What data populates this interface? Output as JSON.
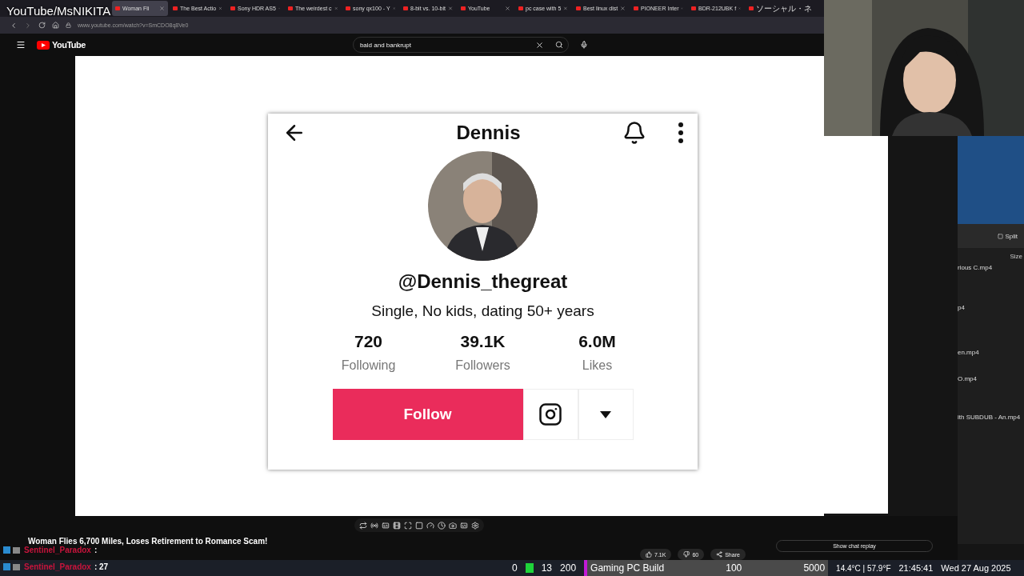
{
  "stream_overlay": {
    "channel": "YouTube/MsNIKITA"
  },
  "browser": {
    "tabs": [
      {
        "label": "Woman Fli",
        "selected": true
      },
      {
        "label": "The Best Actio",
        "selected": false
      },
      {
        "label": "Sony HDR AS5",
        "selected": false
      },
      {
        "label": "The weirdest c",
        "selected": false
      },
      {
        "label": "sony qx100 - Y",
        "selected": false
      },
      {
        "label": "8-bit vs. 10-bit",
        "selected": false
      },
      {
        "label": "YouTube",
        "selected": false
      },
      {
        "label": "pc case with 5",
        "selected": false
      },
      {
        "label": "Best linux dist",
        "selected": false
      },
      {
        "label": "PIONEER Inter",
        "selected": false
      },
      {
        "label": "BDR-212UBK f",
        "selected": false
      },
      {
        "label": "ソーシャル・ネ",
        "selected": false
      }
    ],
    "url": "www.youtube.com/watch?v=SmCDO8q8Ve0"
  },
  "youtube": {
    "logo": "YouTube",
    "search": {
      "value": "bald and bankrupt"
    }
  },
  "profile_card": {
    "name": "Dennis",
    "handle": "@Dennis_thegreat",
    "bio": "Single, No kids, dating 50+ years",
    "stats": [
      {
        "value": "720",
        "label": "Following"
      },
      {
        "value": "39.1K",
        "label": "Followers"
      },
      {
        "value": "6.0M",
        "label": "Likes"
      }
    ],
    "follow_button": "Follow"
  },
  "video_title": "Woman Flies 6,700 Miles, Loses Retirement to Romance Scam!",
  "actions": {
    "likes": "7.1K",
    "dislikes": "60",
    "share": "Share"
  },
  "chat_replay_button": "Show chat replay",
  "chat": [
    {
      "user": "Sentinel_Paradox",
      "text": ":"
    },
    {
      "user": "Sentinel_Paradox",
      "text": ": 27"
    }
  ],
  "file_manager": {
    "toolbar_button": "Split",
    "column": "Size",
    "files": [
      "rious C.mp4",
      "p4",
      "en.mp4",
      "O.mp4",
      "ith SUBDUB - An.mp4"
    ]
  },
  "status_bar": {
    "counters": [
      "0",
      "13",
      "200"
    ],
    "scene": "Gaming PC Build",
    "scene_values": [
      "100",
      "5000"
    ],
    "weather": "14.4°C | 57.9°F",
    "time": "21:45:41",
    "date": "Wed 27 Aug 2025"
  }
}
